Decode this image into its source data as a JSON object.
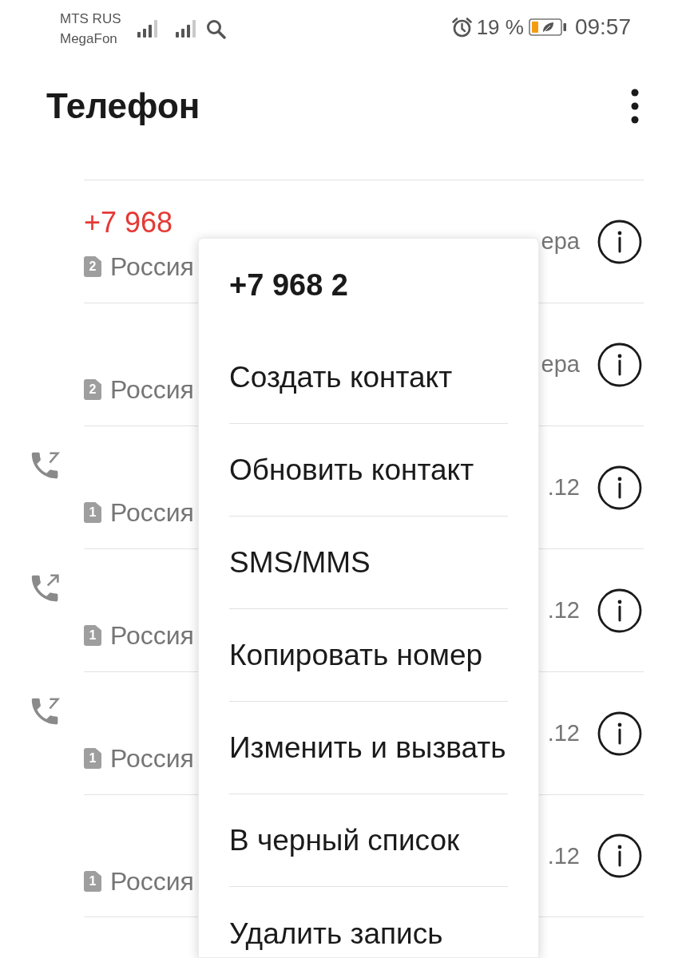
{
  "status_bar": {
    "carriers": [
      "MTS RUS",
      "MegaFon"
    ],
    "battery_percent": "19 %",
    "time": "09:57"
  },
  "app_bar": {
    "title": "Телефон"
  },
  "call_log": [
    {
      "kind": "plain",
      "number": "+7 968",
      "missed": true,
      "sim": "2",
      "location": "Россия",
      "date": "ера"
    },
    {
      "kind": "plain",
      "sim": "2",
      "location": "Россия",
      "date": "ера"
    },
    {
      "kind": "incoming",
      "sim": "1",
      "location": "Россия",
      "date": ".12"
    },
    {
      "kind": "outgoing",
      "sim": "1",
      "location": "Россия",
      "date": ".12"
    },
    {
      "kind": "incoming",
      "sim": "1",
      "location": "Россия",
      "date": ".12"
    },
    {
      "kind": "plain",
      "sim": "1",
      "location": "Россия",
      "date": ".12"
    }
  ],
  "context_menu": {
    "title": "+7 968 2",
    "items": [
      "Создать контакт",
      "Обновить контакт",
      "SMS/MMS",
      "Копировать номер",
      "Изменить и вызвать",
      "В черный список",
      "Удалить запись"
    ]
  }
}
